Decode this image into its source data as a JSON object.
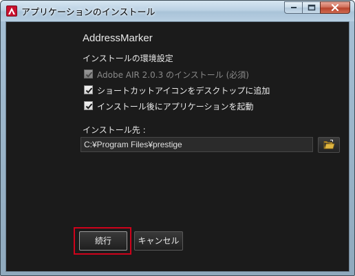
{
  "window": {
    "title": "アプリケーションのインストール",
    "controls": [
      "minimize",
      "maximize",
      "close"
    ]
  },
  "app": {
    "name": "AddressMarker"
  },
  "settings": {
    "section_title": "インストールの環境設定",
    "options": [
      {
        "label": "Adobe AIR 2.0.3 のインストール (必須)",
        "checked": true,
        "disabled": true
      },
      {
        "label": "ショートカットアイコンをデスクトップに追加",
        "checked": true,
        "disabled": false
      },
      {
        "label": "インストール後にアプリケーションを起動",
        "checked": true,
        "disabled": false
      }
    ]
  },
  "location": {
    "label": "インストール先 :",
    "path": "C:¥Program Files¥prestige",
    "browse_icon": "folder-icon"
  },
  "buttons": {
    "continue_label": "続行",
    "cancel_label": "キャンセル"
  },
  "colors": {
    "content_bg": "#1b1b1b",
    "highlight": "#d0021b",
    "close_button": "#c0503a"
  }
}
